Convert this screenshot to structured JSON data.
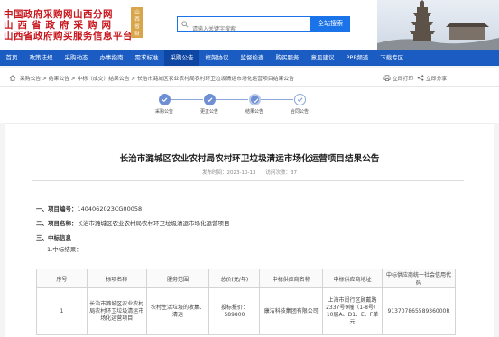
{
  "header": {
    "logo_line1": "中国政府采购网山西分网",
    "logo_line2": "山西省政府采购网",
    "logo_line3": "山西省政府购买服务信息平台",
    "seal_text": "山西省财政厅主办",
    "search_placeholder": "请输入关键字搜索",
    "search_button": "全站搜索",
    "accent": "#1b5cc3",
    "logo_color": "#c8161d"
  },
  "nav": [
    {
      "label": "首页",
      "active": false
    },
    {
      "label": "政策法规",
      "active": false
    },
    {
      "label": "采购动态",
      "active": false
    },
    {
      "label": "办事指南",
      "active": false
    },
    {
      "label": "需求标准",
      "active": false
    },
    {
      "label": "采购公告",
      "active": true
    },
    {
      "label": "框架协议",
      "active": false
    },
    {
      "label": "监督检查",
      "active": false
    },
    {
      "label": "购买服务",
      "active": false
    },
    {
      "label": "意见建议",
      "active": false
    },
    {
      "label": "PPP频道",
      "active": false
    },
    {
      "label": "下载专区",
      "active": false
    }
  ],
  "breadcrumb": {
    "text": "采购公告 > 结果公告 > 中标（成交）结果公告 > 长治市潞城区农业农村局农村环卫垃圾清运市场化运营项目结果公告",
    "print": "立即打印",
    "share": "立即分享"
  },
  "steps": [
    {
      "label": "采购公告",
      "state": "done"
    },
    {
      "label": "更正公告",
      "state": "done"
    },
    {
      "label": "结果公告",
      "state": "current"
    },
    {
      "label": "合同公告",
      "state": "todo"
    }
  ],
  "article": {
    "title": "长治市潞城区农业农村局农村环卫垃圾清运市场化运营项目结果公告",
    "meta": "发布时间：2023-10-13　　访问次数：37",
    "project_no_label": "一、项目编号：",
    "project_no": "1404062023CG00058",
    "project_name_label": "二、项目名称：",
    "project_name": "长治市潞城区农业农村局农村环卫垃圾清运市场化运营项目",
    "section3": "三、中标信息",
    "sub1": "1.中标结果："
  },
  "table": {
    "headers": [
      "序号",
      "标项名称",
      "服务范围",
      "总价(元/年)",
      "中标供应商名称",
      "中标供应商地址",
      "中标供应商统一社会信用代码"
    ],
    "rows": [
      [
        "1",
        "长治市潞城区农业农村局农村环卫垃圾清运市场化运营项目",
        "农村生活垃圾的收集、清运",
        "投标报价：589800",
        "康洁科技集团有限公司",
        "上海市闵行区顾戴路2337号9幢（1-8号）10层A、D1、E、F单元",
        "91370786558936000R"
      ]
    ]
  }
}
